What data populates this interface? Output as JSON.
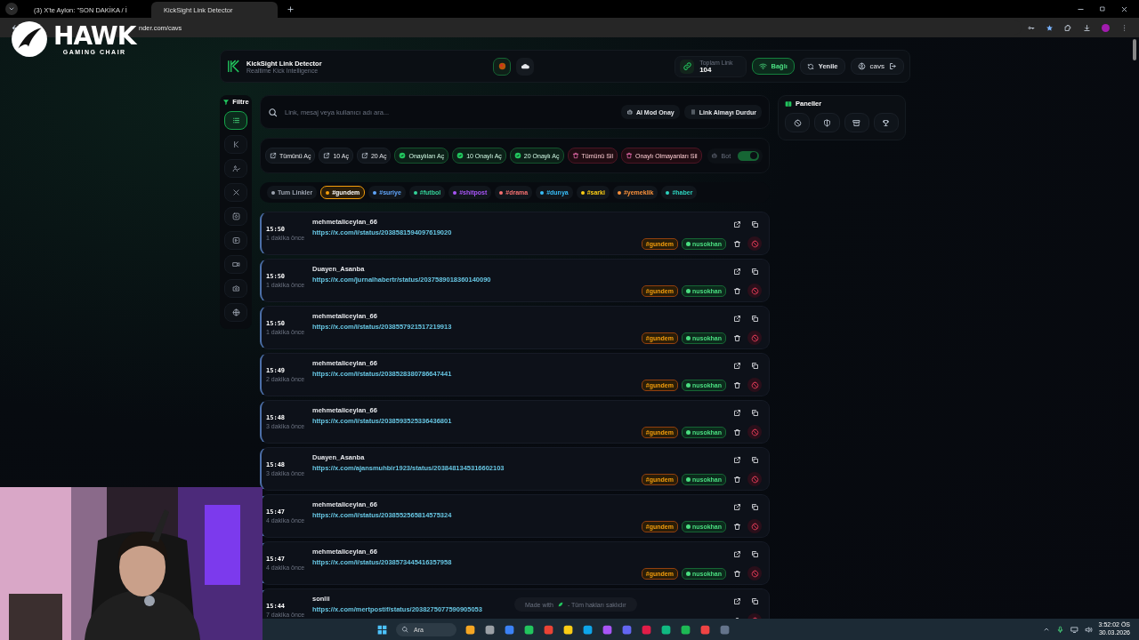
{
  "browser": {
    "tabs": [
      {
        "title": "(3) X'te Aylon: \"SON DAKİKA / İ",
        "selected": false
      },
      {
        "title": "KickSight Link Detector",
        "selected": true
      }
    ],
    "address": "nder.com/cavs"
  },
  "overlay": {
    "brand": "HAWK",
    "tagline": "GAMING CHAIR"
  },
  "header": {
    "title": "KickSight Link Detector",
    "subtitle": "Realtime Kick Intelligence",
    "stat": {
      "label": "Toplam Link",
      "value": "104"
    },
    "connection": {
      "label": "Bağlı",
      "connected": true
    },
    "refresh": "Yenile",
    "user": "cavs"
  },
  "sidebar": {
    "title": "Filtre",
    "items": [
      {
        "kind": "list",
        "selected": true
      },
      {
        "kind": "k",
        "selected": false
      },
      {
        "kind": "user",
        "selected": false
      },
      {
        "kind": "x",
        "selected": false
      },
      {
        "kind": "square",
        "selected": false
      },
      {
        "kind": "play",
        "selected": false
      },
      {
        "kind": "video",
        "selected": false
      },
      {
        "kind": "camera",
        "selected": false
      },
      {
        "kind": "globe",
        "selected": false
      }
    ]
  },
  "search": {
    "placeholder": "Link, mesaj veya kullanıcı adı ara...",
    "buttons": [
      {
        "label": "AI Mod Onay",
        "kind": "robot"
      },
      {
        "label": "Link Almayı Durdur",
        "kind": "pause"
      }
    ]
  },
  "actions": [
    {
      "label": "Tümünü Aç",
      "kind": "open"
    },
    {
      "label": "10 Aç",
      "kind": "open"
    },
    {
      "label": "20 Aç",
      "kind": "open"
    },
    {
      "label": "Onaylıları Aç",
      "kind": "approved"
    },
    {
      "label": "10 Onaylı Aç",
      "kind": "approved"
    },
    {
      "label": "20 Onaylı Aç",
      "kind": "approved"
    },
    {
      "label": "Tümünü Sil",
      "kind": "delete"
    },
    {
      "label": "Onaylı Olmayanları Sil",
      "kind": "delete"
    }
  ],
  "bot": {
    "label": "Bot",
    "on": true
  },
  "tags": [
    {
      "label": "Tum Linkler",
      "color": "#9ca3af",
      "selected": false
    },
    {
      "label": "#gundem",
      "color": "#f59e0b",
      "selected": true
    },
    {
      "label": "#suriye",
      "color": "#60a5fa",
      "selected": false
    },
    {
      "label": "#futbol",
      "color": "#34d399",
      "selected": false
    },
    {
      "label": "#shitpost",
      "color": "#a855f7",
      "selected": false
    },
    {
      "label": "#drama",
      "color": "#f87171",
      "selected": false
    },
    {
      "label": "#dunya",
      "color": "#38bdf8",
      "selected": false
    },
    {
      "label": "#sarki",
      "color": "#facc15",
      "selected": false
    },
    {
      "label": "#yemeklik",
      "color": "#fb923c",
      "selected": false
    },
    {
      "label": "#haber",
      "color": "#2dd4bf",
      "selected": false
    }
  ],
  "links": [
    {
      "time": "15:50",
      "ago": "1 dakika önce",
      "user": "mehmetaliceylan_66",
      "url": "https://x.com/i/status/2038581594097619020",
      "tags": [
        {
          "label": "#gundem",
          "kind": "category"
        },
        {
          "label": "nusokhan",
          "kind": "user"
        }
      ]
    },
    {
      "time": "15:50",
      "ago": "1 dakika önce",
      "user": "Duayen_Asanba",
      "url": "https://x.com/jurnalhabertr/status/2037589018360140090",
      "tags": [
        {
          "label": "#gundem",
          "kind": "category"
        },
        {
          "label": "nusokhan",
          "kind": "user"
        }
      ]
    },
    {
      "time": "15:50",
      "ago": "1 dakika önce",
      "user": "mehmetaliceylan_66",
      "url": "https://x.com/i/status/2038557921517219913",
      "tags": [
        {
          "label": "#gundem",
          "kind": "category"
        },
        {
          "label": "nusokhan",
          "kind": "user"
        }
      ]
    },
    {
      "time": "15:49",
      "ago": "2 dakika önce",
      "user": "mehmetaliceylan_66",
      "url": "https://x.com/i/status/2038528380786647441",
      "tags": [
        {
          "label": "#gundem",
          "kind": "category"
        },
        {
          "label": "nusokhan",
          "kind": "user"
        }
      ]
    },
    {
      "time": "15:48",
      "ago": "3 dakika önce",
      "user": "mehmetaliceylan_66",
      "url": "https://x.com/i/status/2038593525336436801",
      "tags": [
        {
          "label": "#gundem",
          "kind": "category"
        },
        {
          "label": "nusokhan",
          "kind": "user"
        }
      ]
    },
    {
      "time": "15:48",
      "ago": "3 dakika önce",
      "user": "Duayen_Asanba",
      "url": "https://x.com/ajansmuhbir1923/status/2038481345316602103",
      "tags": [
        {
          "label": "#gundem",
          "kind": "category"
        },
        {
          "label": "nusokhan",
          "kind": "user"
        }
      ]
    },
    {
      "time": "15:47",
      "ago": "4 dakika önce",
      "user": "mehmetaliceylan_66",
      "url": "https://x.com/i/status/2038552565814575324",
      "tags": [
        {
          "label": "#gundem",
          "kind": "category"
        },
        {
          "label": "nusokhan",
          "kind": "user"
        }
      ]
    },
    {
      "time": "15:47",
      "ago": "4 dakika önce",
      "user": "mehmetaliceylan_66",
      "url": "https://x.com/i/status/2038573445416357958",
      "tags": [
        {
          "label": "#gundem",
          "kind": "category"
        },
        {
          "label": "nusokhan",
          "kind": "user"
        }
      ]
    },
    {
      "time": "15:44",
      "ago": "7 dakika önce",
      "user": "sonlii",
      "url": "https://x.com/mertpostif/status/2038275077590905053"
    }
  ],
  "panels": {
    "title": "Paneller"
  },
  "footer": {
    "before": "Made with",
    "after": "- Tüm hakları saklıdır"
  },
  "taskbar": {
    "search": "Ara",
    "time": "3:52:02 ÖS",
    "date": "30.03.2026"
  }
}
